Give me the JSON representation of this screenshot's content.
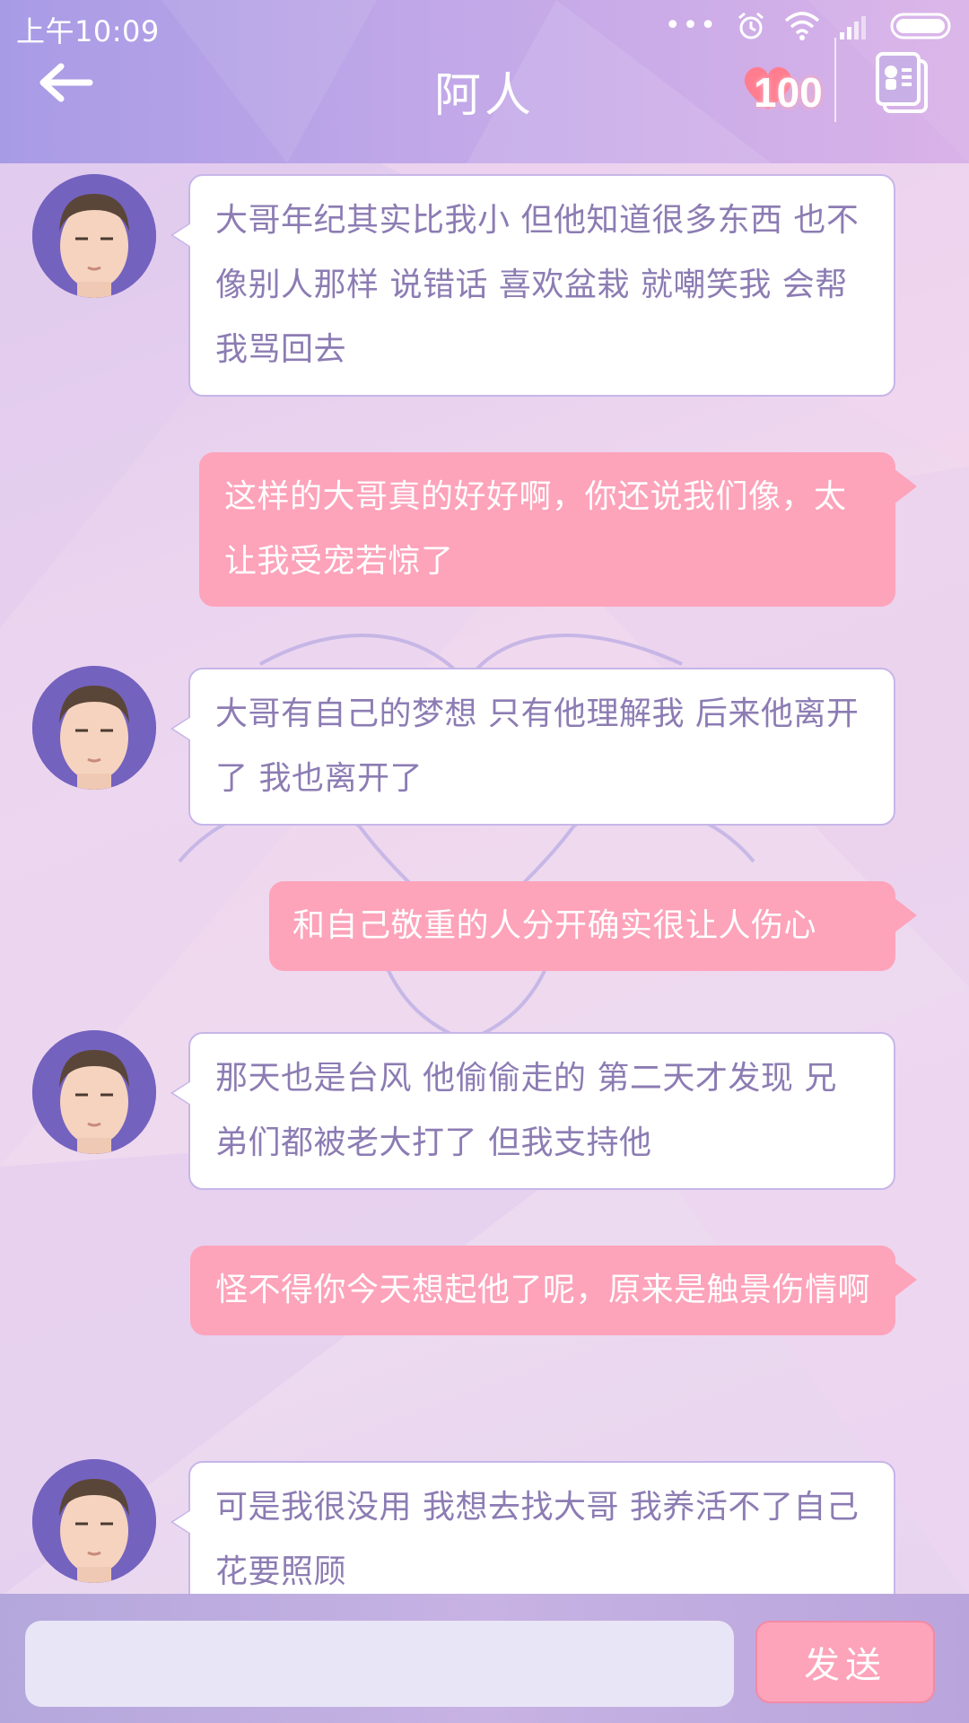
{
  "status_bar": {
    "time": "上午10:09",
    "icons": [
      "more-dots-icon",
      "alarm-icon",
      "wifi-icon",
      "signal-icon",
      "battery-icon"
    ]
  },
  "header": {
    "back_icon": "back-arrow-icon",
    "title": "阿人",
    "affection_icon": "heart-icon",
    "affection_count": "100",
    "profile_icon": "contact-card-icon"
  },
  "messages": [
    {
      "from": "contact",
      "text": "大哥年纪其实比我小 但他知道很多东西 也不像别人那样 说错话 喜欢盆栽 就嘲笑我 会帮我骂回去"
    },
    {
      "from": "me",
      "text": "这样的大哥真的好好啊，你还说我们像，太让我受宠若惊了"
    },
    {
      "from": "contact",
      "text": "大哥有自己的梦想 只有他理解我 后来他离开了 我也离开了"
    },
    {
      "from": "me",
      "text": "和自己敬重的人分开确实很让人伤心"
    },
    {
      "from": "contact",
      "text": "那天也是台风 他偷偷走的 第二天才发现 兄弟们都被老大打了 但我支持他"
    },
    {
      "from": "me",
      "text": "怪不得你今天想起他了呢，原来是触景伤情啊"
    },
    {
      "from": "contact",
      "text": "可是我很没用 我想去找大哥 我养活不了自己 花要照顾"
    }
  ],
  "input_bar": {
    "input_value": "",
    "send_label": "发送"
  },
  "colors": {
    "header_gradient_start": "#a89be6",
    "header_gradient_end": "#d9b2e8",
    "outgoing_bubble": "#fda3ba",
    "incoming_text": "#8c7cb3",
    "send_button": "#fda3ba"
  }
}
